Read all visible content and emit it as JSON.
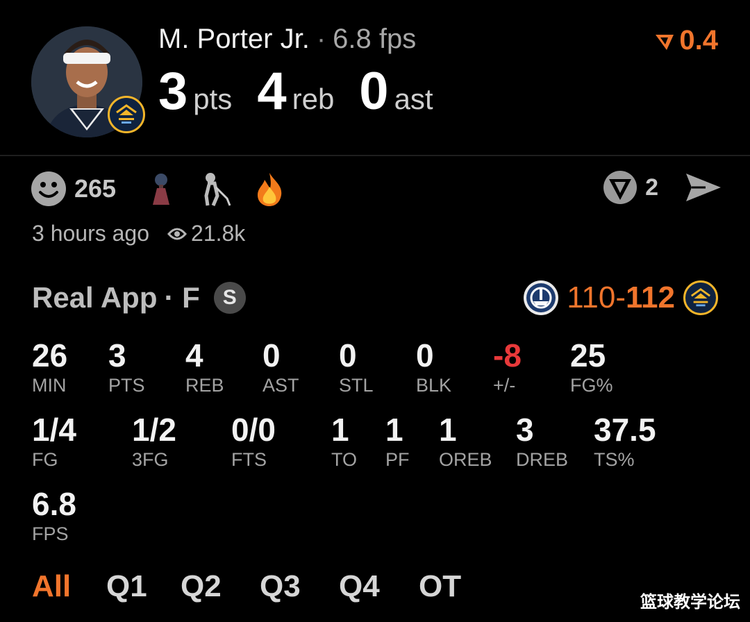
{
  "header": {
    "player_name": "M. Porter Jr.",
    "separator": "·",
    "fps_text": "6.8 fps",
    "delta_value": "0.4",
    "stats": [
      {
        "value": "3",
        "label": "pts"
      },
      {
        "value": "4",
        "label": "reb"
      },
      {
        "value": "0",
        "label": "ast"
      }
    ]
  },
  "reactions": {
    "count": "265",
    "comment_count": "2",
    "time_ago": "3 hours ago",
    "views": "21.8k",
    "emojis": [
      "person-emoji",
      "elder-with-cane-emoji",
      "fire-emoji"
    ]
  },
  "game": {
    "source": "Real App",
    "status": "· F",
    "badge": "S",
    "score_away": "110-",
    "score_home": "112"
  },
  "stats_rows": [
    [
      {
        "value": "26",
        "label": "MIN"
      },
      {
        "value": "3",
        "label": "PTS"
      },
      {
        "value": "4",
        "label": "REB"
      },
      {
        "value": "0",
        "label": "AST"
      },
      {
        "value": "0",
        "label": "STL"
      },
      {
        "value": "0",
        "label": "BLK"
      },
      {
        "value": "-8",
        "label": "+/-"
      },
      {
        "value": "25",
        "label": "FG%"
      }
    ],
    [
      {
        "value": "1/4",
        "label": "FG"
      },
      {
        "value": "1/2",
        "label": "3FG"
      },
      {
        "value": "0/0",
        "label": "FTS"
      },
      {
        "value": "1",
        "label": "TO"
      },
      {
        "value": "1",
        "label": "PF"
      },
      {
        "value": "1",
        "label": "OREB"
      },
      {
        "value": "3",
        "label": "DREB"
      },
      {
        "value": "37.5",
        "label": "TS%"
      }
    ],
    [
      {
        "value": "6.8",
        "label": "FPS"
      }
    ]
  ],
  "tabs": [
    "All",
    "Q1",
    "Q2",
    "Q3",
    "Q4",
    "OT"
  ],
  "active_tab": "All",
  "watermark": "篮球教学论坛",
  "colors": {
    "accent": "#f1752c",
    "negative": "#e8393a",
    "background": "#000000"
  }
}
